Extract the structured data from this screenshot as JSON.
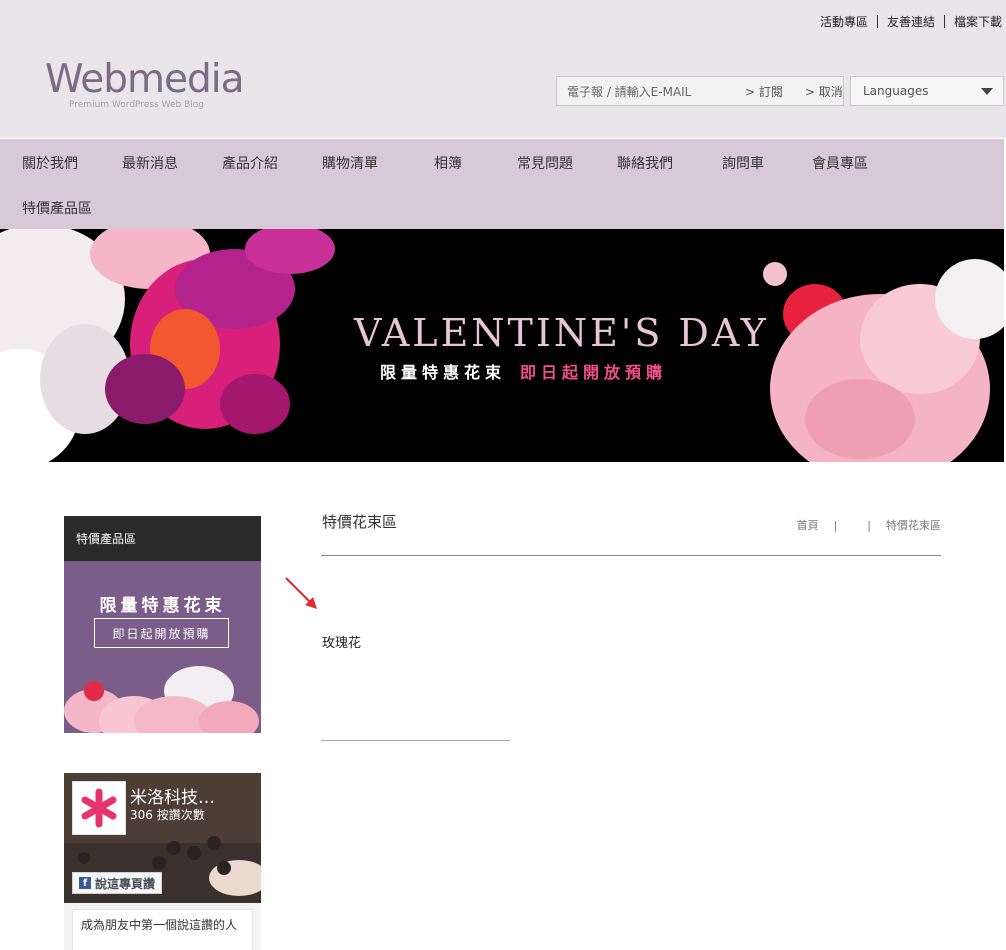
{
  "header": {
    "top_links": [
      "活動專區",
      "友善連結",
      "檔案下載"
    ],
    "logo_name": "Webmedia",
    "logo_tagline": "Premium WordPress Web Blog",
    "newsletter": {
      "placeholder": "電子報 / 請輸入E-MAIL",
      "subscribe": "> 訂閱",
      "cancel": "> 取消"
    },
    "language_select": "Languages"
  },
  "nav": {
    "items": [
      "關於我們",
      "最新消息",
      "產品介紹",
      "購物清單",
      "相簿",
      "常見問題",
      "聯絡我們",
      "詢問車",
      "會員專區",
      "特價產品區"
    ]
  },
  "banner": {
    "title": "VALENTINE'S DAY",
    "sub_white": "限量特惠花束",
    "sub_pink": "即日起開放預購",
    "colors": {
      "background": "#000000",
      "title": "#e8c5d6",
      "accent": "#ef4f8a"
    }
  },
  "sidebar": {
    "heading": "特價產品區",
    "promo_line1": "限量特惠花束",
    "promo_line2": "即日起開放預購",
    "facebook": {
      "page_name": "米洛科技…",
      "likes": "306 按讚次數",
      "like_button": "說這專頁讚",
      "friends_text": "成為朋友中第一個說這讚的人"
    }
  },
  "main": {
    "title": "特價花束區",
    "breadcrumb": [
      "首頁",
      "",
      "特價花束區"
    ],
    "products": [
      "玫瑰花"
    ]
  },
  "colors": {
    "header_bg": "#e9e6e9",
    "nav_bg": "#d8c9d9",
    "logo": "#7c6b85",
    "promo_bg": "#7a5d88"
  }
}
